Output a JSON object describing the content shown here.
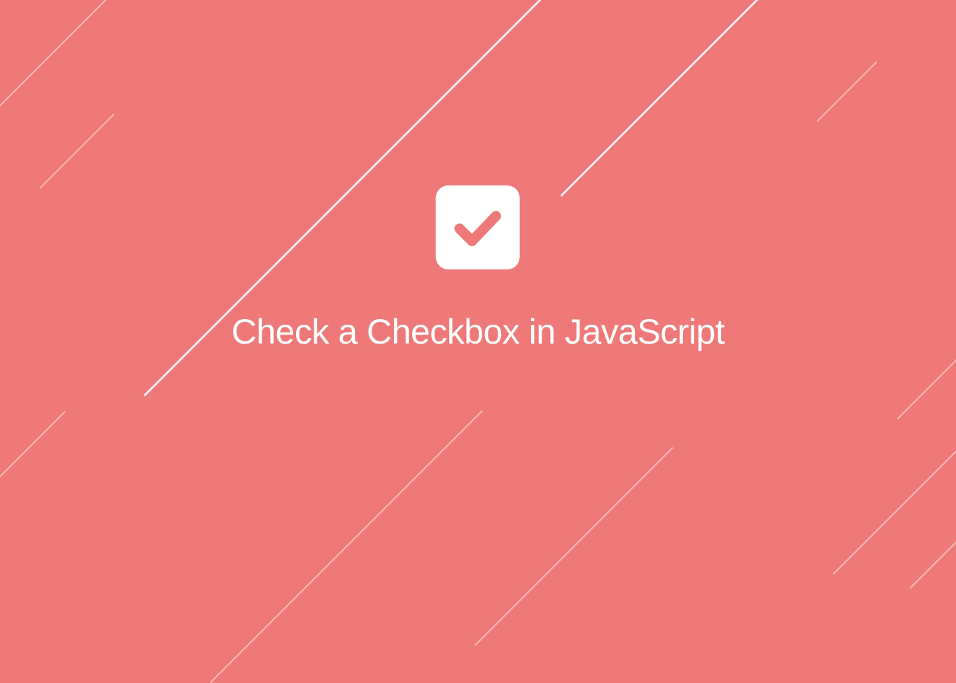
{
  "title": "Check a Checkbox in JavaScript",
  "colors": {
    "background": "#ef7979",
    "foreground": "#ffffff",
    "checkmark": "#ef7979"
  },
  "icon": "checkbox-checked-icon"
}
